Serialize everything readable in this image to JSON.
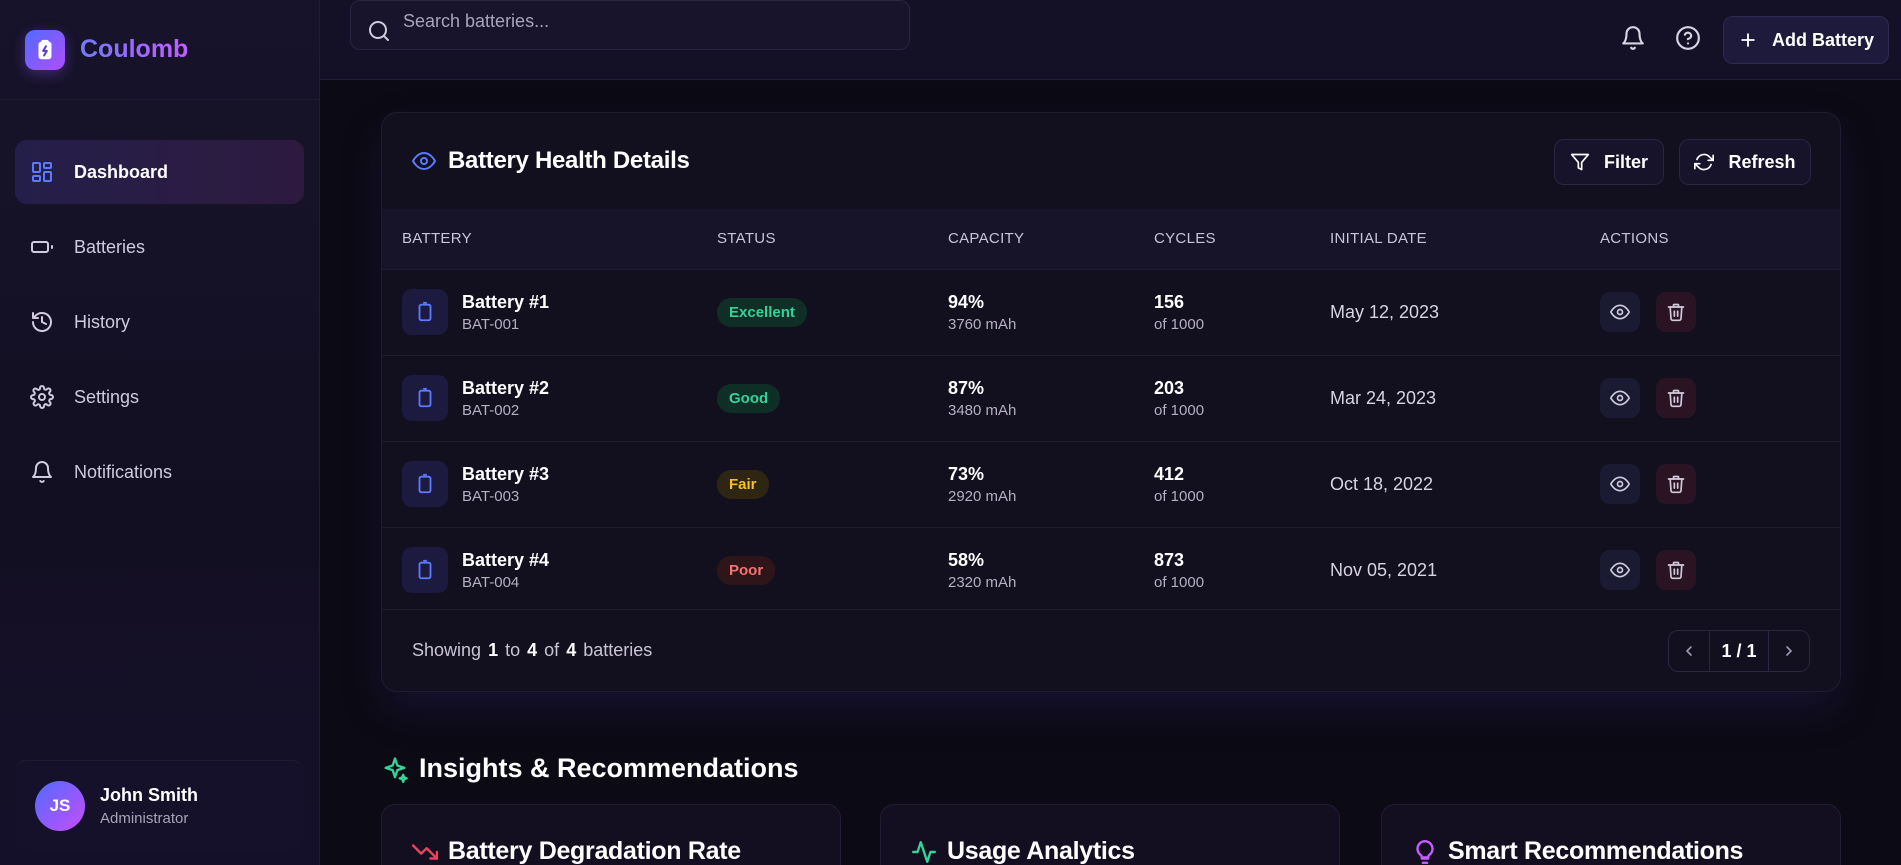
{
  "brand": {
    "name": "Coulomb"
  },
  "sidebar": {
    "items": [
      {
        "label": "Dashboard",
        "icon": "dashboard-icon",
        "active": true
      },
      {
        "label": "Batteries",
        "icon": "battery-icon"
      },
      {
        "label": "History",
        "icon": "history-icon"
      },
      {
        "label": "Settings",
        "icon": "gear-icon"
      },
      {
        "label": "Notifications",
        "icon": "bell-icon"
      }
    ],
    "user": {
      "initials": "JS",
      "name": "John Smith",
      "role": "Administrator"
    }
  },
  "topbar": {
    "search_placeholder": "Search batteries...",
    "add_label": "Add Battery"
  },
  "health": {
    "title": "Battery Health Details",
    "filter_label": "Filter",
    "refresh_label": "Refresh",
    "columns": [
      "BATTERY",
      "STATUS",
      "CAPACITY",
      "CYCLES",
      "INITIAL DATE",
      "ACTIONS"
    ],
    "rows": [
      {
        "name": "Battery #1",
        "code": "BAT-001",
        "status": "Excellent",
        "capacity": "94%",
        "mah": "3760 mAh",
        "cycles": "156",
        "cycles_of": "of 1000",
        "date": "May 12, 2023"
      },
      {
        "name": "Battery #2",
        "code": "BAT-002",
        "status": "Good",
        "capacity": "87%",
        "mah": "3480 mAh",
        "cycles": "203",
        "cycles_of": "of 1000",
        "date": "Mar 24, 2023"
      },
      {
        "name": "Battery #3",
        "code": "BAT-003",
        "status": "Fair",
        "capacity": "73%",
        "mah": "2920 mAh",
        "cycles": "412",
        "cycles_of": "of 1000",
        "date": "Oct 18, 2022"
      },
      {
        "name": "Battery #4",
        "code": "BAT-004",
        "status": "Poor",
        "capacity": "58%",
        "mah": "2320 mAh",
        "cycles": "873",
        "cycles_of": "of 1000",
        "date": "Nov 05, 2021"
      }
    ],
    "footer": {
      "prefix": "Showing",
      "from": "1",
      "to_word": "to",
      "to": "4",
      "of_word": "of",
      "total": "4",
      "suffix": "batteries"
    },
    "page": "1 / 1"
  },
  "status_colors": {
    "Excellent": {
      "fg": "#34d399",
      "bg": "#0f2e26"
    },
    "Good": {
      "fg": "#34d399",
      "bg": "#0f2e26"
    },
    "Fair": {
      "fg": "#fbbf24",
      "bg": "#2e2513"
    },
    "Poor": {
      "fg": "#f87171",
      "bg": "#2e1519"
    }
  },
  "insights": {
    "title": "Insights & Recommendations",
    "cards": [
      {
        "title": "Battery Degradation Rate",
        "icon": "trending-down-icon"
      },
      {
        "title": "Usage Analytics",
        "icon": "activity-icon"
      },
      {
        "title": "Smart Recommendations",
        "icon": "lightbulb-icon"
      }
    ]
  },
  "colors": {
    "accent": "#5b7bff",
    "brand_start": "#4f6bff",
    "brand_end": "#b04dff"
  }
}
